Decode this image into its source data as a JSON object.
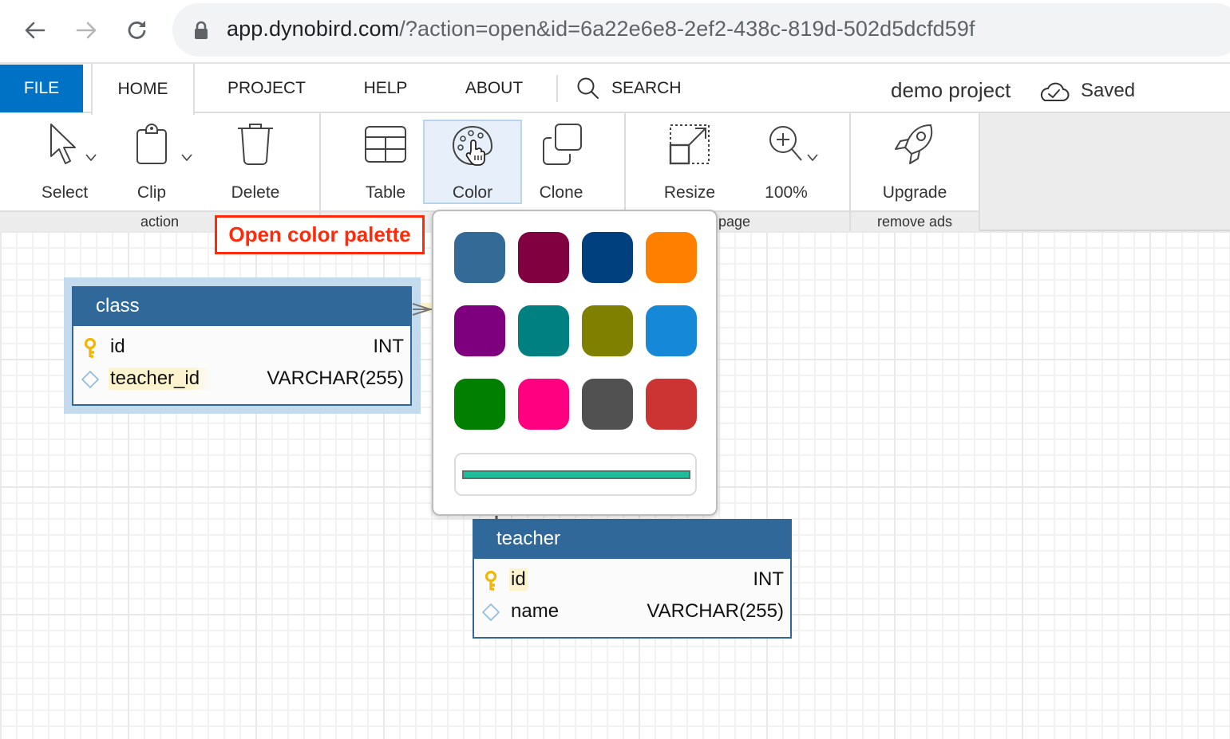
{
  "browser": {
    "url_host": "app.dynobird.com",
    "url_rest": "/?action=open&id=6a22e6e8-2ef2-438c-819d-502d5dcfd59f"
  },
  "menubar": {
    "file": "FILE",
    "tabs": [
      {
        "label": "HOME",
        "active": true
      },
      {
        "label": "PROJECT",
        "active": false
      },
      {
        "label": "HELP",
        "active": false
      },
      {
        "label": "ABOUT",
        "active": false
      }
    ],
    "search": "SEARCH",
    "project_name": "demo project",
    "save_status": "Saved"
  },
  "ribbon": {
    "groups": [
      {
        "label": "action",
        "buttons": [
          {
            "label": "Select"
          },
          {
            "label": "Clip"
          },
          {
            "label": "Delete"
          }
        ]
      },
      {
        "label": "",
        "buttons": [
          {
            "label": "Table"
          },
          {
            "label": "Color",
            "selected": true
          },
          {
            "label": "Clone"
          }
        ]
      },
      {
        "label": "page",
        "buttons": [
          {
            "label": "Resize"
          },
          {
            "label": "100%"
          }
        ]
      },
      {
        "label": "remove ads",
        "buttons": [
          {
            "label": "Upgrade"
          }
        ]
      }
    ]
  },
  "annotation": "Open color palette",
  "palette": {
    "swatches": [
      "#336a96",
      "#800040",
      "#00407f",
      "#ff8000",
      "#7f007f",
      "#008080",
      "#808000",
      "#1588d8",
      "#007f00",
      "#ff0080",
      "#515151",
      "#cc3333"
    ],
    "custom_color": "#1fbc9c"
  },
  "tables": [
    {
      "name": "class",
      "header_color": "#31689a",
      "selected": true,
      "columns": [
        {
          "name": "id",
          "type": "INT",
          "key": "primary"
        },
        {
          "name": "teacher_id",
          "type": "VARCHAR(255)",
          "key": "foreign"
        }
      ]
    },
    {
      "name": "teacher",
      "header_color": "#31689a",
      "selected": false,
      "columns": [
        {
          "name": "id",
          "type": "INT",
          "key": "primary"
        },
        {
          "name": "name",
          "type": "VARCHAR(255)",
          "key": "none"
        }
      ]
    }
  ]
}
